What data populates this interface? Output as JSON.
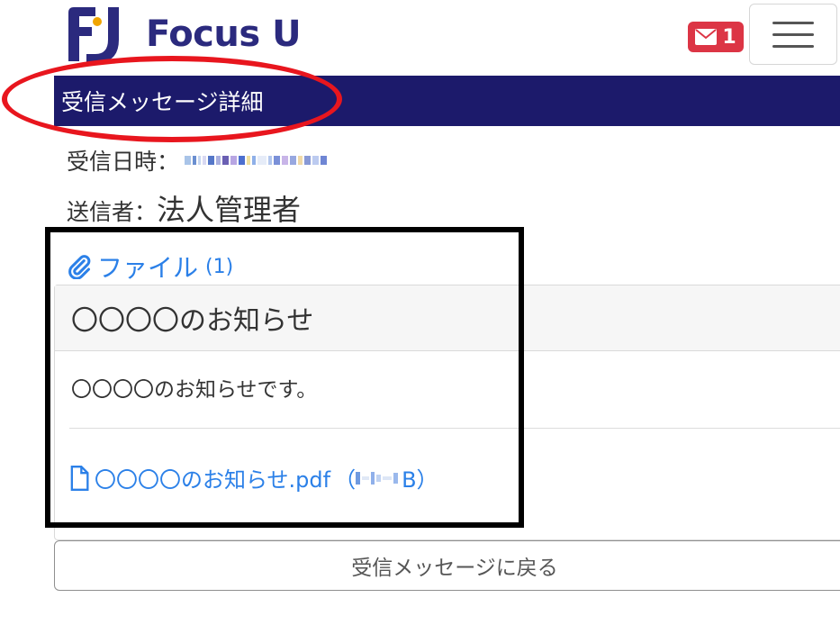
{
  "header": {
    "logo_text": "Focus U",
    "mail_count": "1"
  },
  "title_bar": {
    "title": "受信メッセージ詳細"
  },
  "meta": {
    "received_label": "受信日時：",
    "sender_label": "送信者：",
    "sender_value": "法人管理者"
  },
  "attachments": {
    "label": "ファイル",
    "count": "(1)"
  },
  "card": {
    "title": "〇〇〇〇のお知らせ",
    "body": "〇〇〇〇のお知らせです。",
    "file_name": "〇〇〇〇のお知らせ.pdf",
    "file_size_open": "（",
    "file_size_unit": "B）"
  },
  "footer": {
    "back_button_label": "受信メッセージに戻る"
  },
  "colors": {
    "brand_navy": "#1c1a6b",
    "link_blue": "#2b80e8",
    "badge_red": "#dc3545",
    "annotation_red": "#e8161e"
  }
}
